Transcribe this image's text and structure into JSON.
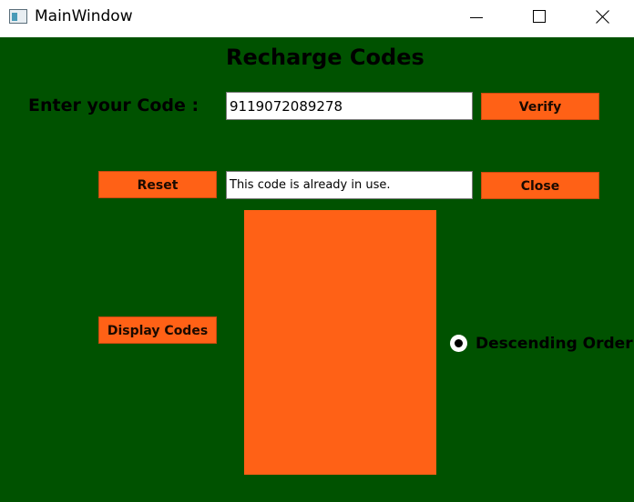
{
  "window": {
    "title": "MainWindow",
    "icon": "app-window-icon"
  },
  "titlebar_controls": {
    "minimize_icon": "minimize-icon",
    "maximize_icon": "maximize-icon",
    "close_icon": "close-icon"
  },
  "main": {
    "heading": "Recharge Codes",
    "code_label": "Enter your Code :",
    "code_value": "9119072089278",
    "verify_label": "Verify",
    "reset_label": "Reset",
    "status_message": "This code is already in use.",
    "close_label": "Close",
    "display_label": "Display Codes",
    "codes_list": [],
    "sort_option": {
      "label": "Descending Order",
      "selected": true
    }
  },
  "colors": {
    "background": "#005200",
    "button": "#ff6116",
    "list": "#ff6116"
  }
}
